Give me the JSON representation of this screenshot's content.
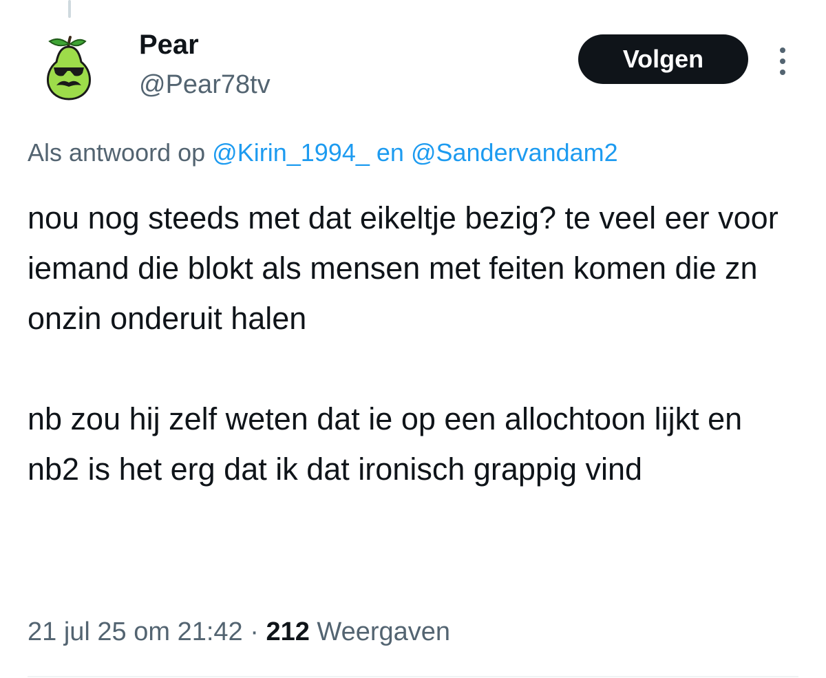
{
  "author": {
    "display_name": "Pear",
    "handle": "@Pear78tv",
    "avatar_icon": "pear-with-sunglasses-and-mustache-avatar"
  },
  "actions": {
    "follow_label": "Volgen",
    "more_icon": "three-dots-vertical-icon"
  },
  "reply_context": {
    "prefix": "Als antwoord op",
    "mention1": "@Kirin_1994_",
    "connector": "en",
    "mention2": "@Sandervandam2"
  },
  "tweet": {
    "paragraph1": "nou nog steeds met dat eikeltje bezig? te veel eer voor iemand die blokt als mensen met feiten komen die zn onzin onderuit halen",
    "paragraph2": "nb zou hij zelf weten dat ie op een allochtoon lijkt en nb2 is het erg dat ik dat ironisch grappig vind"
  },
  "meta": {
    "timestamp": "21 jul 25 om 21:42",
    "separator": "·",
    "views_count": "212",
    "views_label": "Weergaven"
  },
  "colors": {
    "text": "#0f1419",
    "secondary": "#536471",
    "link": "#1d9bf0",
    "button_bg": "#0f1419",
    "avatar_green": "#9ddc4a"
  }
}
